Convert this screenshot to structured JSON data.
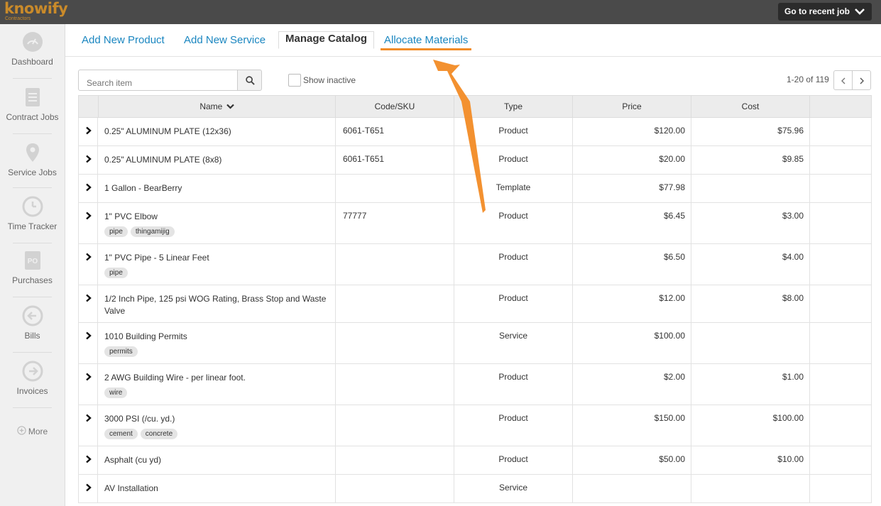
{
  "app": {
    "logo_text": "knowify",
    "logo_sub": "Contractors",
    "recent_job_label": "Go to recent job"
  },
  "sidebar": {
    "items": [
      {
        "label": "Dashboard",
        "icon": "speedometer-icon"
      },
      {
        "label": "Contract Jobs",
        "icon": "document-dollar-icon"
      },
      {
        "label": "Service Jobs",
        "icon": "map-pin-icon"
      },
      {
        "label": "Time Tracker",
        "icon": "clock-icon"
      },
      {
        "label": "Purchases",
        "icon": "purchase-order-icon"
      },
      {
        "label": "Bills",
        "icon": "arrow-left-circle-icon"
      },
      {
        "label": "Invoices",
        "icon": "arrow-right-circle-icon"
      }
    ],
    "more_label": "More"
  },
  "tabs": [
    {
      "label": "Add New Product"
    },
    {
      "label": "Add New Service"
    },
    {
      "label": "Manage Catalog"
    },
    {
      "label": "Allocate Materials"
    }
  ],
  "controls": {
    "search_placeholder": "Search item",
    "show_inactive_label": "Show inactive",
    "pagination_text": "1-20 of 119"
  },
  "table": {
    "columns": [
      "Name",
      "Code/SKU",
      "Type",
      "Price",
      "Cost"
    ],
    "rows": [
      {
        "name": "0.25\" ALUMINUM PLATE (12x36)",
        "code": "6061-T651",
        "type": "Product",
        "price": "$120.00",
        "cost": "$75.96",
        "tags": []
      },
      {
        "name": "0.25\" ALUMINUM PLATE (8x8)",
        "code": "6061-T651",
        "type": "Product",
        "price": "$20.00",
        "cost": "$9.85",
        "tags": []
      },
      {
        "name": "1 Gallon - BearBerry",
        "code": "",
        "type": "Template",
        "price": "$77.98",
        "cost": "",
        "tags": []
      },
      {
        "name": "1\" PVC Elbow",
        "code": "77777",
        "type": "Product",
        "price": "$6.45",
        "cost": "$3.00",
        "tags": [
          "pipe",
          "thingamijig"
        ]
      },
      {
        "name": "1\" PVC Pipe - 5 Linear Feet",
        "code": "",
        "type": "Product",
        "price": "$6.50",
        "cost": "$4.00",
        "tags": [
          "pipe"
        ]
      },
      {
        "name": "1/2 Inch Pipe, 125 psi WOG Rating, Brass Stop and Waste Valve",
        "code": "",
        "type": "Product",
        "price": "$12.00",
        "cost": "$8.00",
        "tags": []
      },
      {
        "name": "1010 Building Permits",
        "code": "",
        "type": "Service",
        "price": "$100.00",
        "cost": "",
        "tags": [
          "permits"
        ]
      },
      {
        "name": "2 AWG Building Wire - per linear foot.",
        "code": "",
        "type": "Product",
        "price": "$2.00",
        "cost": "$1.00",
        "tags": [
          "wire"
        ]
      },
      {
        "name": "3000 PSI (/cu. yd.)",
        "code": "",
        "type": "Product",
        "price": "$150.00",
        "cost": "$100.00",
        "tags": [
          "cement",
          "concrete"
        ]
      },
      {
        "name": "Asphalt (cu yd)",
        "code": "",
        "type": "Product",
        "price": "$50.00",
        "cost": "$10.00",
        "tags": []
      },
      {
        "name": "AV Installation",
        "code": "",
        "type": "Service",
        "price": "",
        "cost": "",
        "tags": []
      }
    ]
  },
  "colors": {
    "accent_orange": "#f28c28",
    "link_blue": "#1a86c0",
    "topbar": "#4a4a4a"
  }
}
